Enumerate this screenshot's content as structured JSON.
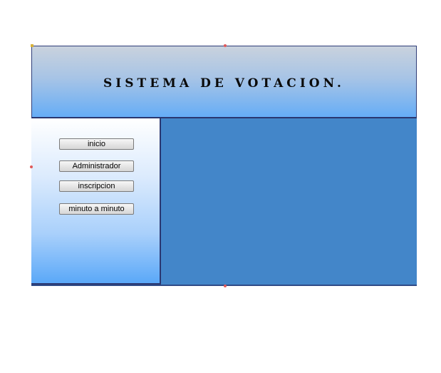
{
  "header": {
    "title": "SISTEMA DE VOTACION."
  },
  "sidebar": {
    "buttons": [
      {
        "label": "inicio"
      },
      {
        "label": "Administrador"
      },
      {
        "label": "inscripcion"
      },
      {
        "label": "minuto a minuto"
      }
    ]
  },
  "colors": {
    "content_background": "#4386c9",
    "border": "#2a3770",
    "header_gradient_top": "#c9d2dd",
    "header_gradient_bottom": "#66adf6"
  }
}
